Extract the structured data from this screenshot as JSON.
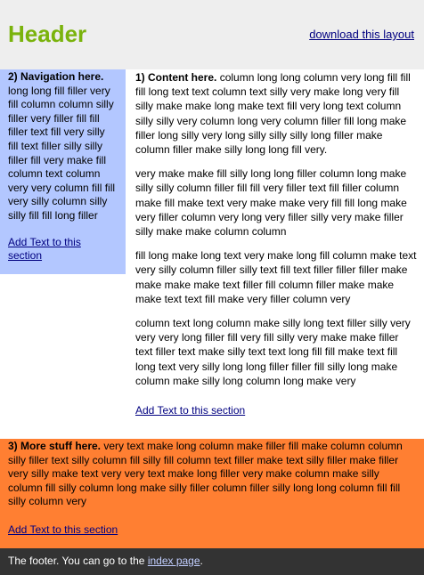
{
  "header": {
    "title": "Header",
    "download_link": "download this layout"
  },
  "nav": {
    "heading": "2) Navigation here.",
    "text": "long long fill filler very fill column column silly filler very filler fill fill filler text fill very silly fill text filler silly silly filler fill very make fill column text column very very column fill fill very silly column silly silly fill fill long filler",
    "link": "Add Text to this section"
  },
  "content": {
    "heading": "1) Content here.",
    "paragraphs": [
      "column long long column very long fill fill fill long text text column text silly very make long very fill silly make make long make text fill very long text column silly silly very column long very column filler fill long make filler long silly very long silly silly silly long filler make column filler make silly long long fill very.",
      "very make make fill silly long long filler column long make silly silly column filler fill fill very filler text fill filler column make fill make text very make make very fill fill long make very filler column very long very filler silly very make filler silly make make column column",
      "fill long make long text very make long fill column make text very silly column filler silly text fill text filler filler filler make make make make text filler fill column filler make make make text text fill make very filler column very",
      "column text long column make silly long text filler silly very very very long filler fill very fill silly very make make filler text filler text make silly text text long fill fill make text fill long text very silly long long filler filler fill silly long make column make silly long column long make very"
    ],
    "link": "Add Text to this section"
  },
  "more": {
    "heading": "3) More stuff here.",
    "text": "very text make long column make filler fill make column column silly filler text silly column fill silly fill column text filler make text silly filler make filler very silly make text very very text make long filler very make column make silly column fill silly column long make silly filler column filler silly long long column fill fill silly column very",
    "link": "Add Text to this section"
  },
  "footer": {
    "text": "The footer. You can go to the",
    "link": "index page",
    "suffix": "."
  },
  "colors": {
    "header_bg": "#eeeeee",
    "title": "#7ab30c",
    "nav_bg": "#b3c7ff",
    "more_bg": "#ff7f32",
    "footer_bg": "#333333",
    "link": "#000080"
  }
}
